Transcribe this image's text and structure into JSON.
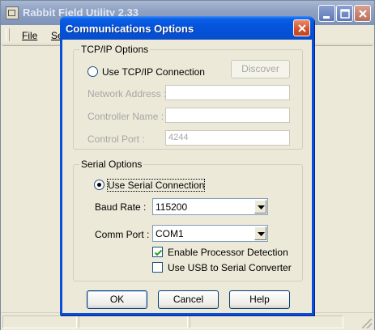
{
  "main_window": {
    "title": "Rabbit Field Utility 2.33",
    "menu": {
      "file": "File",
      "setup_partial": "Se"
    }
  },
  "dialog": {
    "title": "Communications Options",
    "tcp_group": {
      "legend": "TCP/IP Options",
      "use_tcp_label": "Use TCP/IP Connection",
      "discover_label": "Discover",
      "network_address_label": "Network Address :",
      "network_address_value": "",
      "controller_name_label": "Controller Name :",
      "controller_name_value": "",
      "control_port_label": "Control Port :",
      "control_port_value": "4244"
    },
    "serial_group": {
      "legend": "Serial Options",
      "use_serial_label": "Use Serial Connection",
      "baud_rate_label": "Baud Rate :",
      "baud_rate_value": "115200",
      "comm_port_label": "Comm Port :",
      "comm_port_value": "COM1",
      "enable_detection_label": "Enable Processor Detection",
      "enable_detection_checked": true,
      "use_usb_label": "Use USB to Serial Converter",
      "use_usb_checked": false
    },
    "buttons": {
      "ok": "OK",
      "cancel": "Cancel",
      "help": "Help"
    }
  },
  "colors": {
    "dialog_titlebar": "#0555dc",
    "window_face": "#ece9d8",
    "close_button": "#d2502b"
  }
}
